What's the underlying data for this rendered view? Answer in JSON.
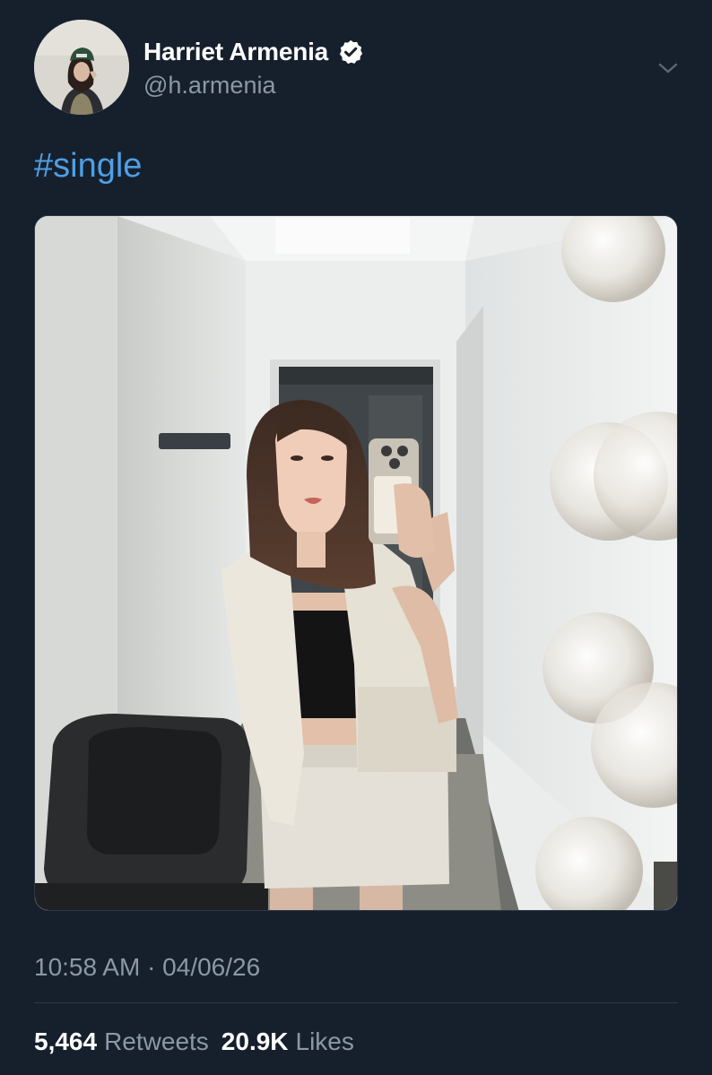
{
  "author": {
    "display_name": "Harriet Armenia",
    "handle": "@h.armenia",
    "verified": true
  },
  "tweet": {
    "text": "#single",
    "hashtag": "#single",
    "timestamp": "10:58 AM · 04/06/26"
  },
  "stats": {
    "retweets_count": "5,464",
    "retweets_label": "Retweets",
    "likes_count": "20.9K",
    "likes_label": "Likes"
  },
  "icons": {
    "verified": "verified-badge-icon",
    "menu": "chevron-down-icon"
  },
  "colors": {
    "background": "#16202d",
    "hashtag": "#4f9fe5",
    "secondary_text": "#8b98a5",
    "primary_text": "#ffffff"
  }
}
